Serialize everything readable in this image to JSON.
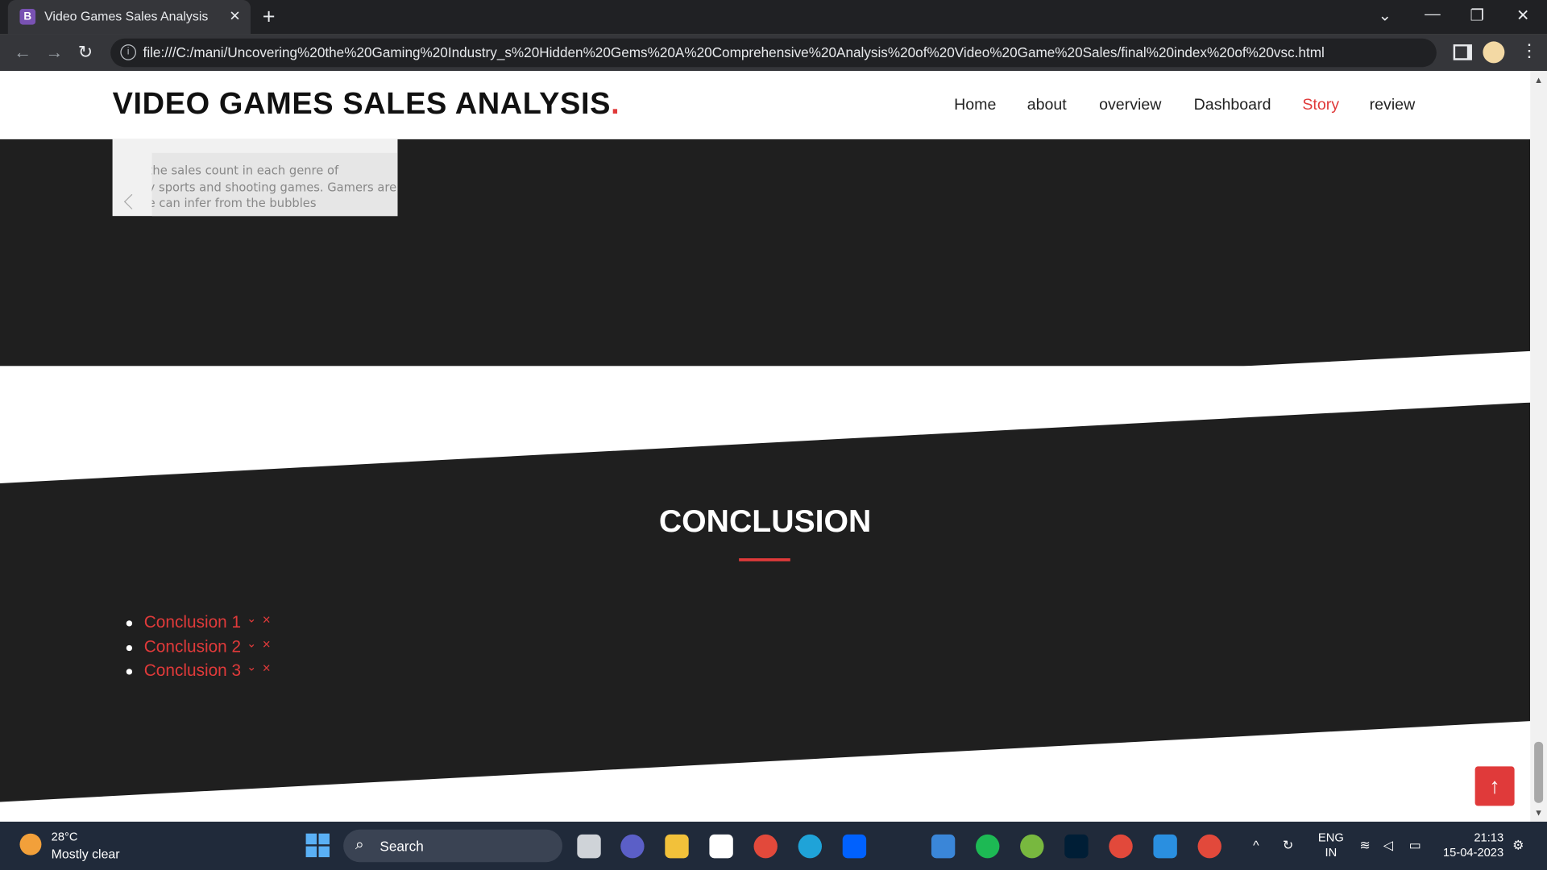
{
  "browser": {
    "tab_title": "Video Games Sales Analysis",
    "tab_favicon": "B",
    "url": "file:///C:/mani/Uncovering%20the%20Gaming%20Industry_s%20Hidden%20Gems%20A%20Comprehensive%20Analysis%20of%20Video%20Game%20Sales/final%20index%20of%20vsc.html"
  },
  "site": {
    "logo": "VIDEO GAMES SALES ANALYSIS",
    "logo_dot": ".",
    "accent_color": "#e03a3a",
    "nav": [
      {
        "label": "Home",
        "active": false
      },
      {
        "label": "about",
        "active": false
      },
      {
        "label": "overview",
        "active": false
      },
      {
        "label": "Dashboard",
        "active": false
      },
      {
        "label": "Story",
        "active": true
      },
      {
        "label": "review",
        "active": false
      }
    ]
  },
  "story_card": {
    "lines": [
      "the sales count in each genre of",
      "y sports and shooting games. Gamers are",
      "e can infer from the bubbles"
    ]
  },
  "conclusion": {
    "title": "CONCLUSION",
    "items": [
      {
        "label": "Conclusion 1",
        "chevron": "⌄",
        "close": "×"
      },
      {
        "label": "Conclusion 2",
        "chevron": "⌄",
        "close": "×"
      },
      {
        "label": "Conclusion 3",
        "chevron": "⌄",
        "close": "×"
      }
    ]
  },
  "back_to_top": {
    "icon": "arrow-up-icon",
    "glyph": "↑"
  },
  "taskbar": {
    "temperature": "28°C",
    "weather": "Mostly clear",
    "search_label": "Search",
    "lang_top": "ENG",
    "lang_bottom": "IN",
    "time": "21:13",
    "date": "15-04-2023"
  }
}
